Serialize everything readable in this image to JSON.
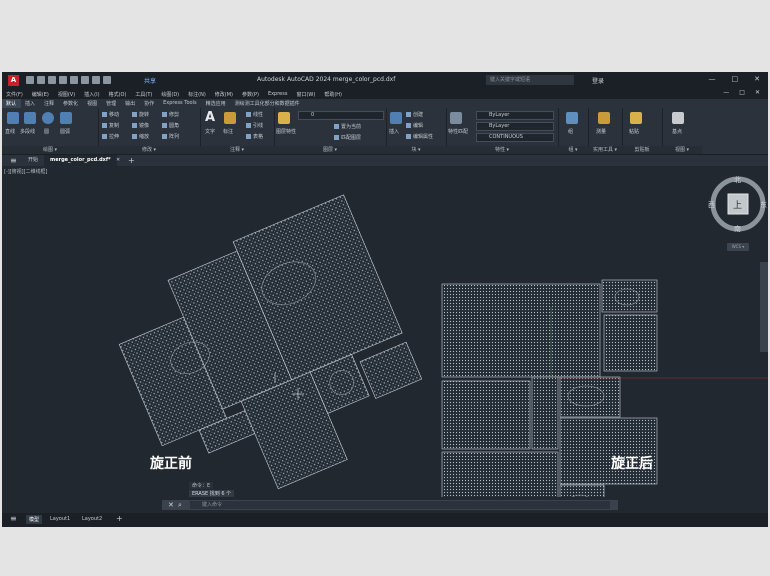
{
  "app": {
    "logo": "A",
    "share": "共享",
    "title": "Autodesk AutoCAD 2024    merge_color_pcd.dxf",
    "search_placeholder": "键入关键字或短语",
    "login": "登录",
    "window_controls": [
      "—",
      "□",
      "✕"
    ],
    "doc_controls": [
      "—",
      "□",
      "✕"
    ]
  },
  "menu": [
    "文件(F)",
    "编辑(E)",
    "视图(V)",
    "插入(I)",
    "格式(O)",
    "工具(T)",
    "绘图(D)",
    "标注(N)",
    "修改(M)",
    "参数(P)",
    "Express",
    "窗口(W)",
    "帮助(H)"
  ],
  "ribbon_tabs": [
    "默认",
    "插入",
    "注释",
    "参数化",
    "视图",
    "管理",
    "输出",
    "协作",
    "Express Tools",
    "精选应用",
    "测绘测工具化部分和数据插件"
  ],
  "ribbon": {
    "draw": {
      "title": "绘图 ▾",
      "tools": [
        "直线",
        "多段线",
        "圆",
        "圆弧"
      ]
    },
    "modify": {
      "title": "修改 ▾",
      "tools": [
        "移动",
        "旋转",
        "修剪",
        "复制",
        "镜像",
        "圆角",
        "拉伸",
        "缩放",
        "阵列"
      ]
    },
    "annotation": {
      "title": "注释 ▾",
      "tools": [
        "文字",
        "标注",
        "线性",
        "引线",
        "表格"
      ]
    },
    "layers": {
      "title": "图层 ▾",
      "tools": [
        "图层特性",
        "置为当前",
        "匹配图层"
      ],
      "layer_value": "0"
    },
    "block": {
      "title": "块 ▾",
      "tools": [
        "插入",
        "创建",
        "编辑",
        "编辑属性"
      ]
    },
    "properties": {
      "title": "特性 ▾",
      "tools": [
        "特性匹配"
      ],
      "color": "ByLayer",
      "lineweight": "ByLayer",
      "linetype": "CONTINUOUS"
    },
    "groups": {
      "title": "组 ▾",
      "tools": [
        "组"
      ]
    },
    "utilities": {
      "title": "实用工具 ▾",
      "tools": [
        "测量"
      ]
    },
    "clipboard": {
      "title": "剪贴板",
      "tools": [
        "粘贴"
      ]
    },
    "base": {
      "title": "视图 ▾",
      "tools": [
        "基点"
      ]
    }
  },
  "doc_tabs": {
    "start": "开始",
    "file": "merge_color_pcd.dxf*",
    "add": "+"
  },
  "viewport_label": "[-][俯视][二维线框]",
  "captions": {
    "before": "旋正前",
    "after": "旋正后"
  },
  "viewcube": {
    "top": "上",
    "north": "北",
    "south": "南",
    "east": "东",
    "west": "西",
    "wcs": "WCS ▾"
  },
  "command": {
    "history_1": "命令：E",
    "history_2": "ERASE 找到 6 个",
    "placeholder": "键入命令"
  },
  "layout_tabs": [
    "模型",
    "Layout1",
    "Layout2",
    "+"
  ]
}
